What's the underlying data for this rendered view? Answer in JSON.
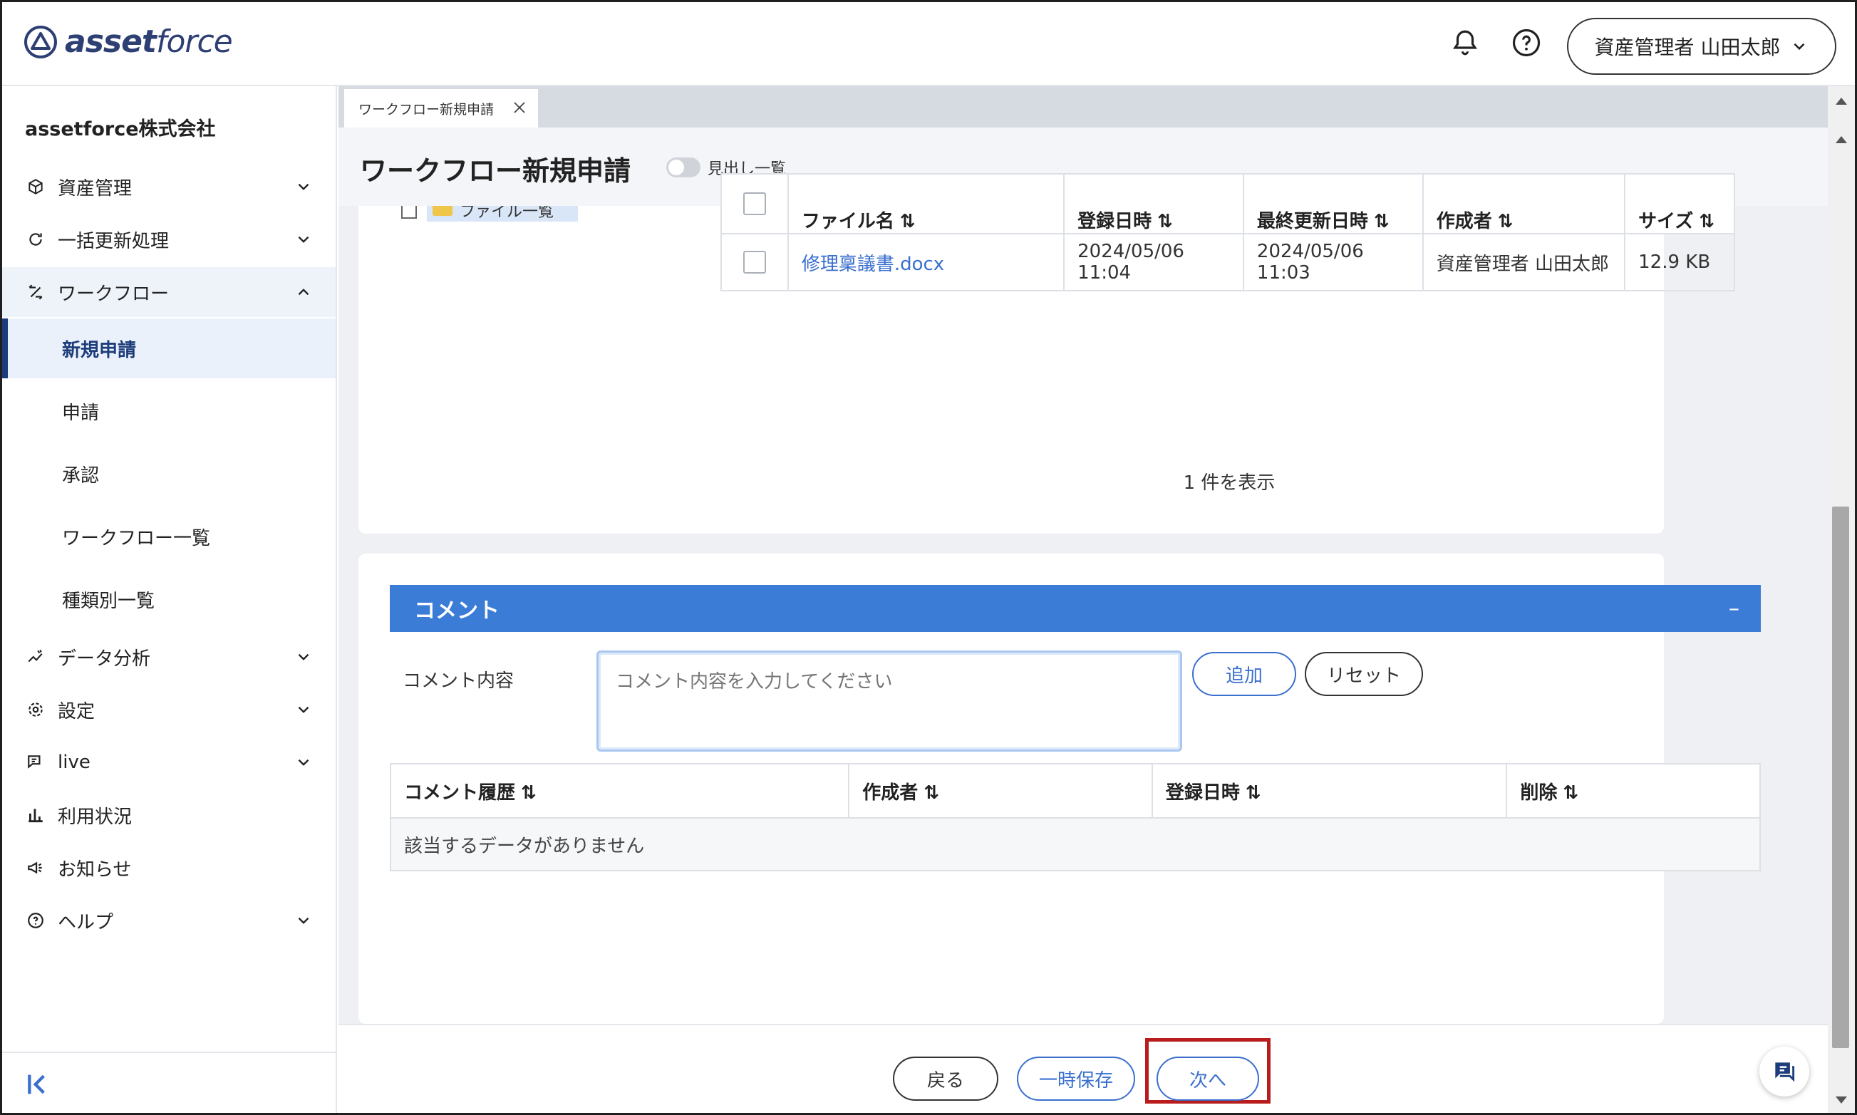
{
  "header": {
    "logo_bold": "asset",
    "logo_light": "force",
    "user_label": "資産管理者 山田太郎"
  },
  "sidebar": {
    "company": "assetforce株式会社",
    "items": [
      {
        "label": "資産管理",
        "icon": "cube-icon"
      },
      {
        "label": "一括更新処理",
        "icon": "refresh-icon"
      },
      {
        "label": "ワークフロー",
        "icon": "workflow-icon"
      },
      {
        "label": "データ分析",
        "icon": "analytics-icon"
      },
      {
        "label": "設定",
        "icon": "gear-icon"
      },
      {
        "label": "live",
        "icon": "live-chat-icon"
      },
      {
        "label": "利用状況",
        "icon": "bar-chart-icon"
      },
      {
        "label": "お知らせ",
        "icon": "megaphone-icon"
      },
      {
        "label": "ヘルプ",
        "icon": "help-icon"
      }
    ],
    "workflow_sub": [
      "新規申請",
      "申請",
      "承認",
      "ワークフロー一覧",
      "種類別一覧"
    ]
  },
  "tab": {
    "label": "ワークフロー新規申請"
  },
  "page": {
    "title": "ワークフロー新規申請",
    "toggle_label": "見出し一覧"
  },
  "file_tree": {
    "folder_label": "ファイル一覧"
  },
  "files": {
    "headers": [
      "ファイル名",
      "登録日時",
      "最終更新日時",
      "作成者",
      "サイズ"
    ],
    "rows": [
      {
        "name": "修理稟議書.docx",
        "registered": "2024/05/06 11:04",
        "updated": "2024/05/06 11:03",
        "author": "資産管理者 山田太郎",
        "size": "12.9 KB"
      }
    ],
    "count_text": "1 件を表示"
  },
  "comment": {
    "section_title": "コメント",
    "collapse_symbol": "–",
    "label": "コメント内容",
    "placeholder": "コメント内容を入力してください",
    "add_label": "追加",
    "reset_label": "リセット",
    "history_headers": [
      "コメント履歴",
      "作成者",
      "登録日時",
      "削除"
    ],
    "empty_text": "該当するデータがありません"
  },
  "footer": {
    "back_label": "戻る",
    "save_label": "一時保存",
    "next_label": "次へ"
  },
  "colors": {
    "accent": "#3b7cd6",
    "link": "#3a6fce",
    "highlight": "#b81c1c"
  }
}
